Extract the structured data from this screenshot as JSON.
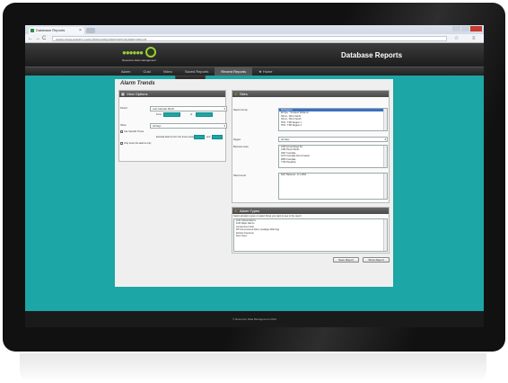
{
  "browser": {
    "tab_title": "Database Reports",
    "tab_close": "×",
    "url": "www.resourcedm.com/dbreports/alarmtrends/alarmreport",
    "nav_back": "←",
    "nav_forward": "→",
    "nav_reload": "C",
    "addr_star": "☆",
    "addr_menu": "≡"
  },
  "site": {
    "logo_dots": "●●●●●●",
    "logo_text": "Resource data management",
    "title": "Database Reports",
    "menu": [
      "Alarm",
      "Cust",
      "Video",
      "Saved Reports",
      "Recent Reports"
    ],
    "menu_home": "Home",
    "menu_home_icon": "★",
    "dropdown_item": "Saved Reports",
    "footer": "© Resource Data Management 2014"
  },
  "page": {
    "title": "Alarm Trends"
  },
  "view_options": {
    "header": "View Options",
    "icon": "▦",
    "period_label": "Period",
    "period_value": "Last Calendar Month",
    "from_label": "From",
    "to_label": "to",
    "show_label": "Show",
    "show_value": "All Days",
    "use_times_label": "Use Specific Times",
    "exclude_label": "Exclude Alarms from the times shown",
    "and_label": "and",
    "only_label": "Only show the alarms only"
  },
  "sites": {
    "header": "Sites",
    "icon": "⚠",
    "report_group_label": "Report Group",
    "report_groups": [
      "All Regions",
      "Europe - Scotland Midlands",
      "NCLA - NCLA North",
      "NCLA - NCLA South",
      "TPR - TPR Region 1",
      "TPR - TPR Region 2"
    ],
    "region_label": "Region",
    "region_value": "All Sites",
    "business_area_label": "Business Area",
    "business_areas": [
      "1025 Arnold Road 28",
      "1480 Haxel Sheffs",
      "2097 Irvandale",
      "2270 Irvandale Denni Gaulet",
      "2836 Irvandale",
      "7726 Haxelbhs"
    ],
    "sites_label": "Sites Found",
    "sites_list": [
      "5207 Balwood - D.J.2052"
    ]
  },
  "alarm_types": {
    "header": "Alarm Types",
    "icon": "⚠",
    "hint": "Select all alarm types or select those you want to see in the report",
    "items": [
      "1112 Critical Alarms",
      "1110 Major Alarms",
      "Compressor Fault",
      "DP Low pressure Alarm (Leakage Warning)",
      "Defrost Overtemp",
      "Door Open"
    ]
  },
  "buttons": {
    "save": "Save Report",
    "show": "Show Report"
  }
}
